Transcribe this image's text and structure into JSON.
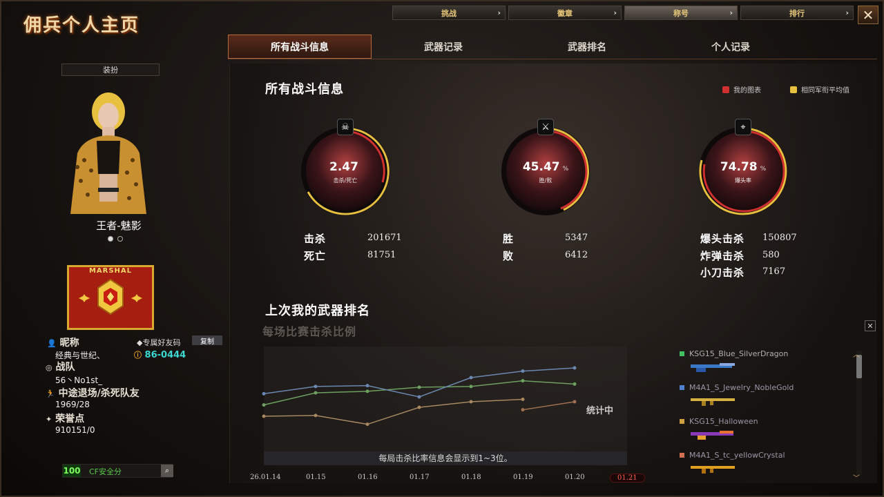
{
  "app": {
    "title": "佣兵个人主页"
  },
  "top_tabs": [
    {
      "label": "挑战",
      "active": false
    },
    {
      "label": "徽章",
      "active": false
    },
    {
      "label": "称号",
      "active": true
    },
    {
      "label": "排行",
      "active": false
    }
  ],
  "sub_tabs": [
    {
      "label": "所有战斗信息",
      "active": true
    },
    {
      "label": "武器记录",
      "active": false
    },
    {
      "label": "武器排名",
      "active": false
    },
    {
      "label": "个人记录",
      "active": false
    }
  ],
  "profile": {
    "dress_label": "装扮",
    "character_name": "王者-魅影",
    "rank_text": "MARSHAL",
    "nickname_label": "昵称",
    "nickname": "经典与世纪、",
    "friend_code_label": "专属好友码",
    "copy_label": "复制",
    "friend_code": "86-0444",
    "team_label": "战队",
    "team": "56丶No1st_",
    "quit_label": "中途退场/杀死队友",
    "quit_value": "1969/28",
    "honor_label": "荣誉点",
    "honor_value": "910151/0",
    "safe_score": "100",
    "safe_label": "CF安全分"
  },
  "overview": {
    "title": "所有战斗信息",
    "legend_mine": "我的图表",
    "legend_avg": "相同军衔平均值",
    "legend_mine_color": "#d03030",
    "legend_avg_color": "#e8c040",
    "gauges": [
      {
        "value": "2.47",
        "unit": "",
        "sub": "击杀/死亡",
        "icon": "☠"
      },
      {
        "value": "45.47",
        "unit": "%",
        "sub": "胜/败",
        "icon": "⚔"
      },
      {
        "value": "74.78",
        "unit": "%",
        "sub": "爆头率",
        "icon": "⌖"
      }
    ],
    "stats": {
      "kills_label": "击杀",
      "kills": "201671",
      "deaths_label": "死亡",
      "deaths": "81751",
      "wins_label": "胜",
      "wins": "5347",
      "losses_label": "败",
      "losses": "6412",
      "headshot_label": "爆头击杀",
      "headshot": "150807",
      "bomb_label": "炸弹击杀",
      "bomb": "580",
      "knife_label": "小刀击杀",
      "knife": "7167"
    }
  },
  "weapon_rank": {
    "title": "上次我的武器排名",
    "subtitle": "每场比赛击杀比例",
    "status": "统计中",
    "note": "每局击杀比率信息会显示到1~3位。",
    "weapons": [
      {
        "name": "KSG15_Blue_SilverDragon",
        "color": "#40c060"
      },
      {
        "name": "M4A1_S_Jewelry_NobleGold",
        "color": "#5080d0"
      },
      {
        "name": "KSG15_Halloween",
        "color": "#d0a040"
      },
      {
        "name": "M4A1_S_tc_yellowCrystal",
        "color": "#d07050"
      }
    ]
  },
  "chart_data": {
    "type": "line",
    "title": "每场比赛击杀比例",
    "categories": [
      "26.01.14",
      "01.15",
      "01.16",
      "01.17",
      "01.18",
      "01.19",
      "01.20",
      "01.21"
    ],
    "series": [
      {
        "name": "KSG15_Blue_SilverDragon",
        "color": "#6ea060",
        "values": [
          0.56,
          0.71,
          0.73,
          0.78,
          0.79,
          0.86,
          0.82,
          null
        ]
      },
      {
        "name": "M4A1_S_Jewelry_NobleGold",
        "color": "#6a88b0",
        "values": [
          0.7,
          0.79,
          0.8,
          0.66,
          0.9,
          0.98,
          1.02,
          null
        ]
      },
      {
        "name": "KSG15_Halloween",
        "color": "#a88860",
        "values": [
          0.42,
          0.43,
          0.32,
          0.53,
          0.6,
          0.63,
          null,
          null
        ]
      },
      {
        "name": "M4A1_S_tc_yellowCrystal",
        "color": "#a07050",
        "values": [
          null,
          null,
          null,
          null,
          null,
          0.5,
          0.6,
          null
        ]
      }
    ],
    "ylim": [
      0,
      1.2
    ],
    "active_category": "01.21"
  }
}
